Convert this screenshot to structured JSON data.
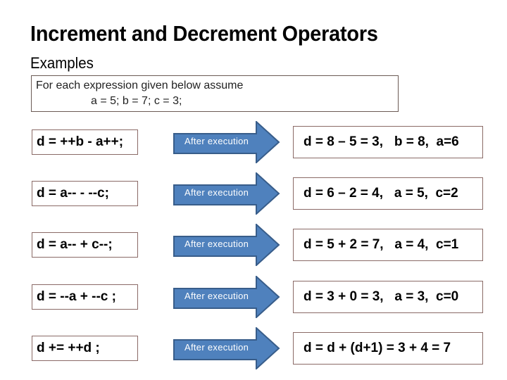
{
  "header": {
    "title": "Increment and Decrement Operators",
    "subtitle": "Examples"
  },
  "intro": {
    "line1": "For each expression given below assume",
    "line2": "a = 5; b = 7; c = 3;"
  },
  "colors": {
    "arrow_fill": "#4f81bd",
    "arrow_border": "#385d8a",
    "box_border": "#8a6a66"
  },
  "rows": [
    {
      "expression": "d = ++b - a++;",
      "arrow_label": "After  execution",
      "result": "d = 8 – 5 = 3,   b = 8,  a=6"
    },
    {
      "expression": " d = a-- - --c;",
      "arrow_label": "After  execution",
      "result": "d = 6 – 2 = 4,   a = 5,  c=2"
    },
    {
      "expression": "d = a-- +  c--;",
      "arrow_label": "After  execution",
      "result": "d = 5 + 2 = 7,   a = 4,  c=1"
    },
    {
      "expression": "d = --a  + --c ;",
      "arrow_label": "After  execution",
      "result": "d = 3 + 0 = 3,   a = 3,  c=0"
    },
    {
      "expression": "d += ++d ;",
      "arrow_label": "After  execution",
      "result": "d = d + (d+1) = 3 + 4 = 7"
    }
  ]
}
